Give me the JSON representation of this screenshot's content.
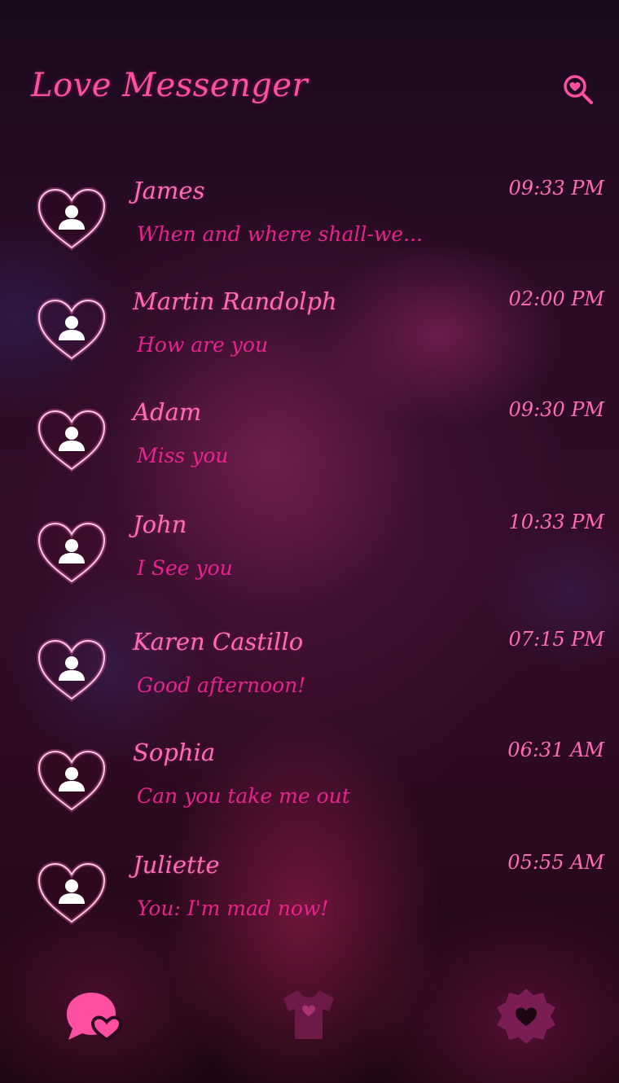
{
  "app": {
    "title": "Love Messenger"
  },
  "colors": {
    "accent": "#ff4fa0",
    "message": "#e8238d",
    "inactive_icon": "#6e1a48"
  },
  "icons": {
    "search": "search-heart-icon",
    "avatar": "heart-person-icon",
    "chats_tab": "chat-heart-icon",
    "themes_tab": "shirt-heart-icon",
    "settings_tab": "gear-heart-icon"
  },
  "conversations": [
    {
      "name": "James",
      "message": "When and where shall-we...",
      "time": "09:33 PM"
    },
    {
      "name": "Martin Randolph",
      "message": "How are you",
      "time": "02:00 PM"
    },
    {
      "name": "Adam",
      "message": "Miss you",
      "time": "09:30 PM"
    },
    {
      "name": "John",
      "message": "I See you",
      "time": "10:33 PM"
    },
    {
      "name": "Karen Castillo",
      "message": "Good afternoon!",
      "time": "07:15 PM"
    },
    {
      "name": "Sophia",
      "message": "Can you take me out",
      "time": "06:31 AM"
    },
    {
      "name": "Juliette",
      "message": "You: I'm mad now!",
      "time": "05:55 AM"
    }
  ]
}
